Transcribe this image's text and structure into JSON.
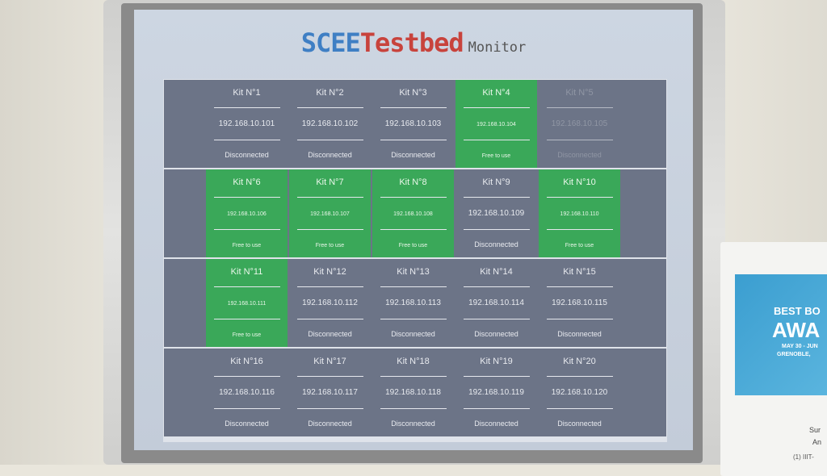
{
  "header": {
    "part1": "SCEE",
    "part2": "Testbed",
    "part3": "Monitor"
  },
  "rows": [
    [
      {
        "name": "Kit N°1",
        "ip": "192.168.10.101",
        "status": "Disconnected",
        "state": "disconnected"
      },
      {
        "name": "Kit N°2",
        "ip": "192.168.10.102",
        "status": "Disconnected",
        "state": "disconnected"
      },
      {
        "name": "Kit N°3",
        "ip": "192.168.10.103",
        "status": "Disconnected",
        "state": "disconnected"
      },
      {
        "name": "Kit N°4",
        "ip": "192.168.10.104",
        "status": "Free to use",
        "state": "free"
      },
      {
        "name": "Kit N°5",
        "ip": "192.168.10.105",
        "status": "Disconnected",
        "state": "dim"
      }
    ],
    [
      {
        "name": "Kit N°6",
        "ip": "192.168.10.106",
        "status": "Free to use",
        "state": "free"
      },
      {
        "name": "Kit N°7",
        "ip": "192.168.10.107",
        "status": "Free to use",
        "state": "free"
      },
      {
        "name": "Kit N°8",
        "ip": "192.168.10.108",
        "status": "Free to use",
        "state": "free"
      },
      {
        "name": "Kit N°9",
        "ip": "192.168.10.109",
        "status": "Disconnected",
        "state": "disconnected"
      },
      {
        "name": "Kit N°10",
        "ip": "192.168.10.110",
        "status": "Free to use",
        "state": "free"
      }
    ],
    [
      {
        "name": "Kit N°11",
        "ip": "192.168.10.111",
        "status": "Free to use",
        "state": "free"
      },
      {
        "name": "Kit N°12",
        "ip": "192.168.10.112",
        "status": "Disconnected",
        "state": "disconnected"
      },
      {
        "name": "Kit N°13",
        "ip": "192.168.10.113",
        "status": "Disconnected",
        "state": "disconnected"
      },
      {
        "name": "Kit N°14",
        "ip": "192.168.10.114",
        "status": "Disconnected",
        "state": "disconnected"
      },
      {
        "name": "Kit N°15",
        "ip": "192.168.10.115",
        "status": "Disconnected",
        "state": "disconnected"
      }
    ],
    [
      {
        "name": "Kit N°16",
        "ip": "192.168.10.116",
        "status": "Disconnected",
        "state": "disconnected"
      },
      {
        "name": "Kit N°17",
        "ip": "192.168.10.117",
        "status": "Disconnected",
        "state": "disconnected"
      },
      {
        "name": "Kit N°18",
        "ip": "192.168.10.118",
        "status": "Disconnected",
        "state": "disconnected"
      },
      {
        "name": "Kit N°19",
        "ip": "192.168.10.119",
        "status": "Disconnected",
        "state": "disconnected"
      },
      {
        "name": "Kit N°20",
        "ip": "192.168.10.120",
        "status": "Disconnected",
        "state": "disconnected"
      }
    ]
  ],
  "colors": {
    "free": "#3aa859",
    "row_bg": "#6c7487",
    "title_blue": "#3f7fc4",
    "title_red": "#c8433c"
  },
  "side_card": {
    "line1": "BEST BO",
    "line2": "AWA",
    "line3": "MAY 30 - JUN",
    "line4": "GRENOBLE,",
    "line5": "Sur",
    "line6": "An",
    "line7": "(1) IIIT-"
  }
}
